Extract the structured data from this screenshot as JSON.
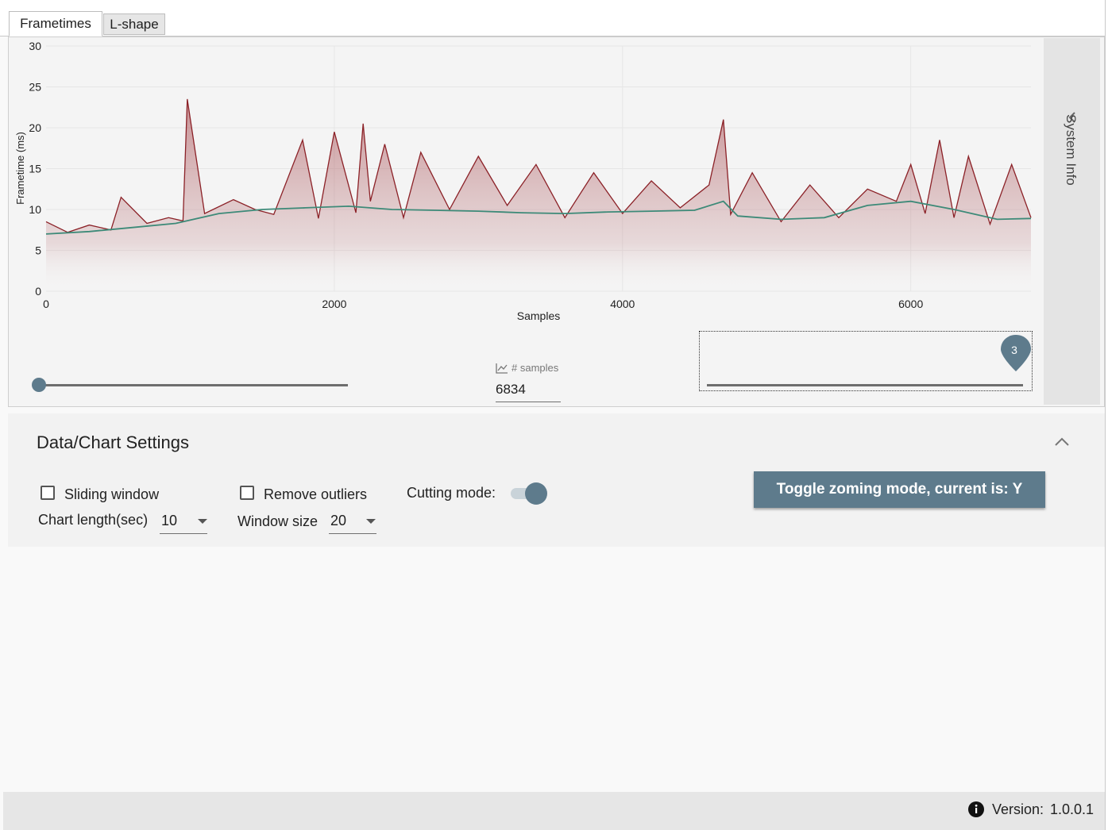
{
  "tabs": [
    {
      "label": "Frametimes",
      "active": true
    },
    {
      "label": "L-shape",
      "active": false
    }
  ],
  "side_panel": {
    "label": "System Info",
    "icon": "chevron-left-icon"
  },
  "samples": {
    "caption": "# samples",
    "value": "6834",
    "icon": "chart-line-icon"
  },
  "range_slider": {
    "bubble_value": "3"
  },
  "settings": {
    "title": "Data/Chart Settings",
    "sliding_window_label": "Sliding window",
    "sliding_window_checked": false,
    "remove_outliers_label": "Remove outliers",
    "remove_outliers_checked": false,
    "cutting_mode_label": "Cutting mode:",
    "cutting_mode_on": true,
    "chart_length_label": "Chart length(sec)",
    "chart_length_value": "10",
    "window_size_label": "Window size",
    "window_size_value": "20",
    "zoom_button_label": "Toggle zoming mode, current is: Y"
  },
  "status": {
    "version_label": "Version:",
    "version_value": "1.0.0.1"
  },
  "colors": {
    "frametime_line": "#8b2127",
    "moving_avg_line": "#3d8a78",
    "accent": "#5e7b8c"
  },
  "chart_data": {
    "type": "area",
    "xlabel": "Samples",
    "ylabel": "Frametime (ms)",
    "xlim": [
      0,
      6834
    ],
    "ylim": [
      0,
      30
    ],
    "x_ticks": [
      0,
      2000,
      4000,
      6000
    ],
    "y_ticks": [
      0,
      5,
      10,
      15,
      20,
      25,
      30
    ],
    "grid": true,
    "series": [
      {
        "name": "",
        "color": "#8b2127",
        "x": [
          0,
          150,
          300,
          450,
          520,
          700,
          850,
          950,
          980,
          1100,
          1300,
          1450,
          1580,
          1780,
          1890,
          2000,
          2150,
          2200,
          2250,
          2350,
          2480,
          2600,
          2800,
          3000,
          3200,
          3400,
          3600,
          3800,
          4000,
          4200,
          4400,
          4600,
          4700,
          4750,
          4900,
          5100,
          5300,
          5500,
          5700,
          5900,
          6000,
          6100,
          6200,
          6300,
          6400,
          6550,
          6700,
          6834
        ],
        "y": [
          8.5,
          7.2,
          8.1,
          7.5,
          11.5,
          8.3,
          9.0,
          8.6,
          23.5,
          9.5,
          11.2,
          10.0,
          9.4,
          18.5,
          8.9,
          19.5,
          9.6,
          20.5,
          11.0,
          18.0,
          9.0,
          17.0,
          10.0,
          16.5,
          10.5,
          15.5,
          9.0,
          14.5,
          9.5,
          13.5,
          10.2,
          13.0,
          21.0,
          9.4,
          14.5,
          8.5,
          13.0,
          9.0,
          12.5,
          11.0,
          15.5,
          9.5,
          18.5,
          9.0,
          16.5,
          8.2,
          15.5,
          9.0
        ]
      },
      {
        "name": "",
        "color": "#3d8a78",
        "x": [
          0,
          300,
          600,
          900,
          1200,
          1500,
          1800,
          2100,
          2400,
          2700,
          3000,
          3300,
          3600,
          3900,
          4200,
          4500,
          4700,
          4800,
          5100,
          5400,
          5700,
          6000,
          6300,
          6600,
          6834
        ],
        "y": [
          7.0,
          7.3,
          7.8,
          8.3,
          9.5,
          10.0,
          10.2,
          10.4,
          10.0,
          9.9,
          9.8,
          9.6,
          9.5,
          9.7,
          9.8,
          9.9,
          11.0,
          9.2,
          8.8,
          9.0,
          10.5,
          11.0,
          10.0,
          8.8,
          8.9
        ]
      }
    ]
  }
}
